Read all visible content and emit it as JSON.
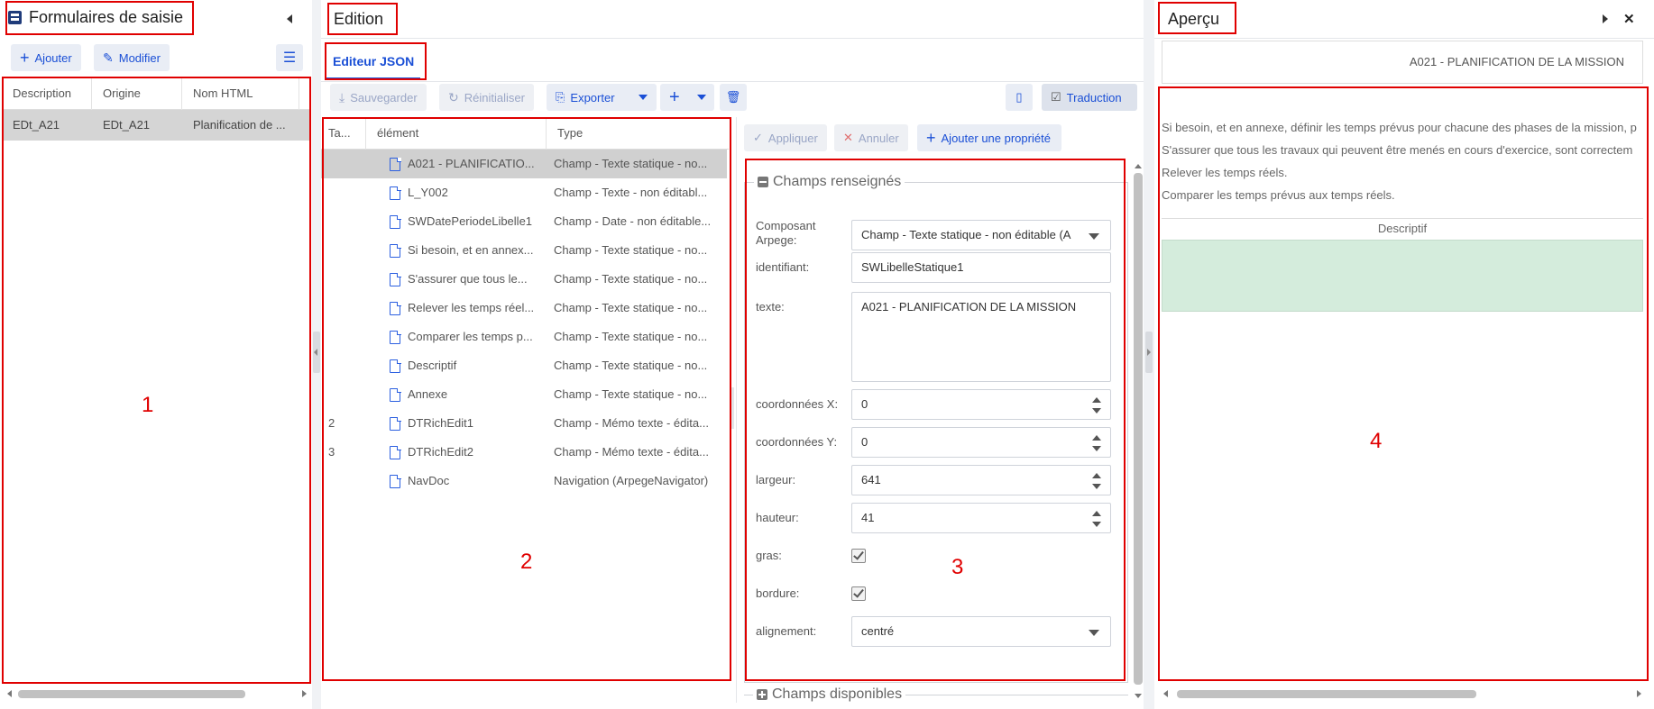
{
  "left": {
    "title": "Formulaires de saisie",
    "add_label": "Ajouter",
    "edit_label": "Modifier",
    "columns": [
      "Description",
      "Origine",
      "Nom HTML"
    ],
    "rows": [
      {
        "description": "EDt_A21",
        "origine": "EDt_A21",
        "nom_html": "Planification de ..."
      }
    ],
    "annotation": "1"
  },
  "edition": {
    "title": "Edition",
    "tab": "Editeur JSON",
    "toolbar": {
      "save": "Sauvegarder",
      "reset": "Réinitialiser",
      "export": "Exporter",
      "translate": "Traduction"
    },
    "tree_columns": [
      "Ta...",
      "élément",
      "Type"
    ],
    "tree_rows": [
      {
        "ta": "",
        "element": "A021 - PLANIFICATIO...",
        "type": "Champ - Texte statique - no...",
        "selected": true
      },
      {
        "ta": "",
        "element": "L_Y002",
        "type": "Champ - Texte - non éditabl..."
      },
      {
        "ta": "",
        "element": "SWDatePeriodeLibelle1",
        "type": "Champ - Date - non éditable..."
      },
      {
        "ta": "",
        "element": "Si besoin, et en annex...",
        "type": "Champ - Texte statique - no..."
      },
      {
        "ta": "",
        "element": "S'assurer que tous le...",
        "type": "Champ - Texte statique - no..."
      },
      {
        "ta": "",
        "element": "Relever les temps réel...",
        "type": "Champ - Texte statique - no..."
      },
      {
        "ta": "",
        "element": "Comparer les temps p...",
        "type": "Champ - Texte statique - no..."
      },
      {
        "ta": "",
        "element": "Descriptif",
        "type": "Champ - Texte statique - no..."
      },
      {
        "ta": "",
        "element": "Annexe",
        "type": "Champ - Texte statique - no..."
      },
      {
        "ta": "2",
        "element": "DTRichEdit1",
        "type": "Champ - Mémo texte - édita..."
      },
      {
        "ta": "3",
        "element": "DTRichEdit2",
        "type": "Champ - Mémo texte - édita..."
      },
      {
        "ta": "",
        "element": "NavDoc",
        "type": "Navigation (ArpegeNavigator)"
      }
    ],
    "props": {
      "apply": "Appliquer",
      "cancel": "Annuler",
      "add_prop": "Ajouter une propriété",
      "section_filled": "Champs renseignés",
      "section_available": "Champs disponibles",
      "composant_label": "Composant Arpege:",
      "composant_value": "Champ - Texte statique - non éditable (A",
      "identifiant_label": "identifiant:",
      "identifiant_value": "SWLibelleStatique1",
      "texte_label": "texte:",
      "texte_value": "A021 - PLANIFICATION DE LA MISSION",
      "x_label": "coordonnées X:",
      "x_value": "0",
      "y_label": "coordonnées Y:",
      "y_value": "0",
      "largeur_label": "largeur:",
      "largeur_value": "641",
      "hauteur_label": "hauteur:",
      "hauteur_value": "41",
      "gras_label": "gras:",
      "bordure_label": "bordure:",
      "align_label": "alignement:",
      "align_value": "centré"
    },
    "annotation_tree": "2",
    "annotation_props": "3"
  },
  "apercu": {
    "title": "Aperçu",
    "heading": "A021 - PLANIFICATION DE LA MISSION",
    "lines": [
      "Si besoin, et en annexe, définir les temps prévus pour chacune des phases de la mission, p",
      "S'assurer que tous les travaux qui peuvent être menés en cours d'exercice, sont correctem",
      "Relever les temps réels.",
      "Comparer les temps prévus aux temps réels."
    ],
    "descriptif": "Descriptif",
    "annotation": "4"
  },
  "colors": {
    "accent": "#1a4fd6",
    "highlight": "red",
    "green_area": "#d4ecdc"
  }
}
